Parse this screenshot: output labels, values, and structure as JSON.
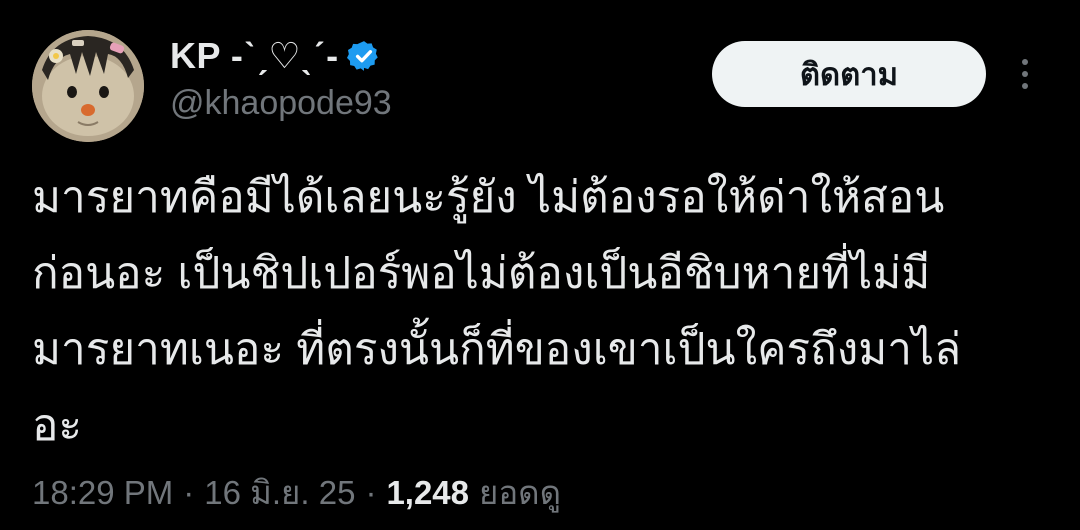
{
  "author": {
    "display_name": "KP -ˋˏ♡ˎˊ-",
    "handle": "@khaopode93",
    "verified": true,
    "verified_color": "#1d9bf0"
  },
  "actions": {
    "follow_label": "ติดตาม",
    "more_icon": "more-horizontal-icon"
  },
  "tweet": {
    "lines": [
      "มารยาทคือมีได้เลยนะรู้ยัง ไม่ต้องรอให้ด่าให้สอน",
      "ก่อนอะ เป็นชิปเปอร์พอไม่ต้องเป็นอีชิบหายที่ไม่มี",
      "มารยาทเนอะ ที่ตรงนั้นก็ที่ของเขาเป็นใครถึงมาไล่",
      "อะ"
    ]
  },
  "meta": {
    "time": "18:29 PM",
    "separator": "·",
    "date": "16 มิ.ย. 25",
    "views_count": "1,248",
    "views_label": "ยอดดู"
  },
  "colors": {
    "background": "#000000",
    "primary_text": "#e7e9ea",
    "secondary_text": "#71767b",
    "follow_bg": "#eff3f4"
  }
}
